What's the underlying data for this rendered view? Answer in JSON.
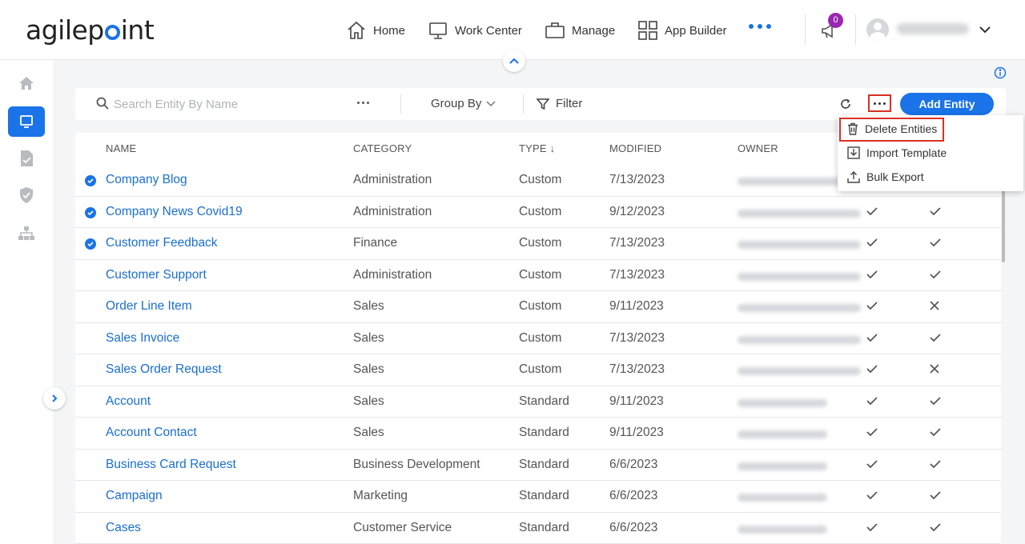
{
  "brand": {
    "logo_left": "agilep",
    "logo_right": "int"
  },
  "nav": {
    "items": [
      {
        "label": "Home",
        "icon": "home-icon"
      },
      {
        "label": "Work Center",
        "icon": "monitor-icon"
      },
      {
        "label": "Manage",
        "icon": "briefcase-icon"
      },
      {
        "label": "App Builder",
        "icon": "grid-icon"
      }
    ],
    "notification_count": "0"
  },
  "toolbar": {
    "search_placeholder": "Search Entity By Name",
    "group_by_label": "Group By",
    "filter_label": "Filter",
    "add_button_label": "Add Entity"
  },
  "menu": {
    "items": [
      {
        "label": "Delete Entities",
        "icon": "trash-icon"
      },
      {
        "label": "Import Template",
        "icon": "import-icon"
      },
      {
        "label": "Bulk Export",
        "icon": "export-icon"
      }
    ]
  },
  "table": {
    "headers": {
      "name": "NAME",
      "category": "CATEGORY",
      "type": "TYPE",
      "type_sort": "↓",
      "modified": "MODIFIED",
      "owner": "OWNER"
    },
    "rows": [
      {
        "name": "Company Blog",
        "category": "Administration",
        "type": "Custom",
        "modified": "7/13/2023",
        "selected": true,
        "col1": "check",
        "col2": "check"
      },
      {
        "name": "Company News Covid19",
        "category": "Administration",
        "type": "Custom",
        "modified": "9/12/2023",
        "selected": true,
        "col1": "check",
        "col2": "check"
      },
      {
        "name": "Customer Feedback",
        "category": "Finance",
        "type": "Custom",
        "modified": "7/13/2023",
        "selected": true,
        "col1": "check",
        "col2": "check"
      },
      {
        "name": "Customer Support",
        "category": "Administration",
        "type": "Custom",
        "modified": "7/13/2023",
        "selected": false,
        "col1": "check",
        "col2": "check"
      },
      {
        "name": "Order Line Item",
        "category": "Sales",
        "type": "Custom",
        "modified": "9/11/2023",
        "selected": false,
        "col1": "check",
        "col2": "cross"
      },
      {
        "name": "Sales Invoice",
        "category": "Sales",
        "type": "Custom",
        "modified": "7/13/2023",
        "selected": false,
        "col1": "check",
        "col2": "check"
      },
      {
        "name": "Sales Order Request",
        "category": "Sales",
        "type": "Custom",
        "modified": "7/13/2023",
        "selected": false,
        "col1": "check",
        "col2": "cross"
      },
      {
        "name": "Account",
        "category": "Sales",
        "type": "Standard",
        "modified": "9/11/2023",
        "selected": false,
        "col1": "check",
        "col2": "check"
      },
      {
        "name": "Account Contact",
        "category": "Sales",
        "type": "Standard",
        "modified": "9/11/2023",
        "selected": false,
        "col1": "check",
        "col2": "check"
      },
      {
        "name": "Business Card Request",
        "category": "Business Development",
        "type": "Standard",
        "modified": "6/6/2023",
        "selected": false,
        "col1": "check",
        "col2": "check"
      },
      {
        "name": "Campaign",
        "category": "Marketing",
        "type": "Standard",
        "modified": "6/6/2023",
        "selected": false,
        "col1": "check",
        "col2": "check"
      },
      {
        "name": "Cases",
        "category": "Customer Service",
        "type": "Standard",
        "modified": "6/6/2023",
        "selected": false,
        "col1": "check",
        "col2": "check"
      }
    ]
  },
  "colors": {
    "accent": "#1a73e8",
    "link": "#1a6fd0",
    "highlight": "#d93025",
    "badge": "#9c27b0"
  }
}
